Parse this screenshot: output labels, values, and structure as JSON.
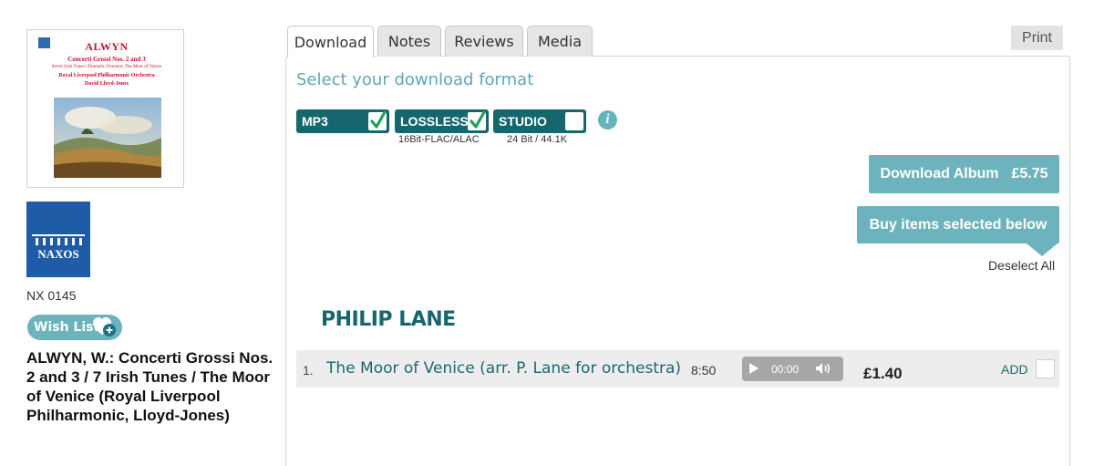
{
  "album": {
    "cover": {
      "title": "ALWYN",
      "line1": "Concerti Grossi Nos. 2 and 3",
      "line2": "Seven Irish Tunes • Dramatic Overture: The Moor of Venice",
      "line3": "Royal Liverpool Philharmonic Orchestra",
      "line4": "David Lloyd-Jones"
    },
    "label_name": "NAXOS",
    "catalog_number": "NX 0145",
    "wishlist_label": "Wish List",
    "title": "ALWYN, W.: Concerti Grossi Nos. 2 and 3 / 7 Irish Tunes / The Moor of Venice (Royal Liverpool Philharmonic, Lloyd-Jones)"
  },
  "tabs": [
    {
      "label": "Download",
      "active": true
    },
    {
      "label": "Notes",
      "active": false
    },
    {
      "label": "Reviews",
      "active": false
    },
    {
      "label": "Media",
      "active": false
    }
  ],
  "print_label": "Print",
  "download": {
    "heading": "Select your download format",
    "formats": [
      {
        "label": "MP3",
        "checked": true,
        "sub": ""
      },
      {
        "label": "LOSSLESS",
        "checked": true,
        "sub": "16Bit-FLAC/ALAC"
      },
      {
        "label": "STUDIO",
        "checked": false,
        "sub": "24 Bit / 44.1K"
      }
    ],
    "download_album_label": "Download Album",
    "download_album_price": "£5.75",
    "buy_selected_label": "Buy items selected below",
    "deselect_all_label": "Deselect All"
  },
  "composer": "PHILIP LANE",
  "tracks": [
    {
      "number": "1.",
      "title": "The Moor of Venice (arr. P. Lane for orchestra)",
      "duration": "8:50",
      "player_time": "00:00",
      "price": "£1.40",
      "add_label": "ADD"
    }
  ],
  "colors": {
    "accent": "#6cb3be",
    "dark_teal": "#16666e",
    "title_teal": "#17656e",
    "label_blue": "#1e5ca8"
  }
}
